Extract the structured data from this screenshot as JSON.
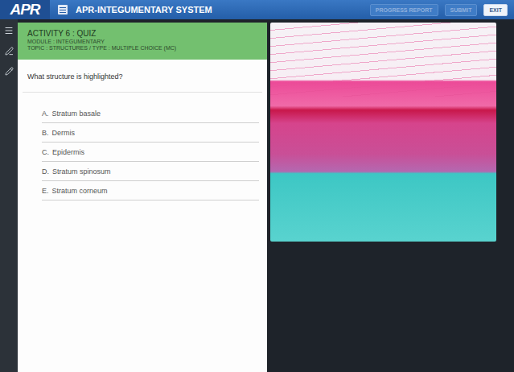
{
  "topbar": {
    "logo": "APR",
    "title": "APR-INTEGUMENTARY SYSTEM",
    "buttons": [
      {
        "label": "PROGRESS REPORT",
        "disabled": true
      },
      {
        "label": "SUBMIT",
        "disabled": true
      },
      {
        "label": "EXIT",
        "disabled": false
      }
    ]
  },
  "activity": {
    "title": "ACTIVITY 6 : QUIZ",
    "module": "MODULE : INTEGUMENTARY",
    "topic": "TOPIC : STRUCTURES  /  TYPE : MULTIPLE CHOICE (MC)"
  },
  "question": "What structure is highlighted?",
  "options": [
    {
      "letter": "A.",
      "label": "Stratum basale",
      "selected": false
    },
    {
      "letter": "B.",
      "label": "Dermis",
      "selected": false
    },
    {
      "letter": "C.",
      "label": "Epidermis",
      "selected": false
    },
    {
      "letter": "D.",
      "label": "Stratum spinosum",
      "selected": false
    },
    {
      "letter": "E.",
      "label": "Stratum corneum",
      "selected": false
    }
  ]
}
